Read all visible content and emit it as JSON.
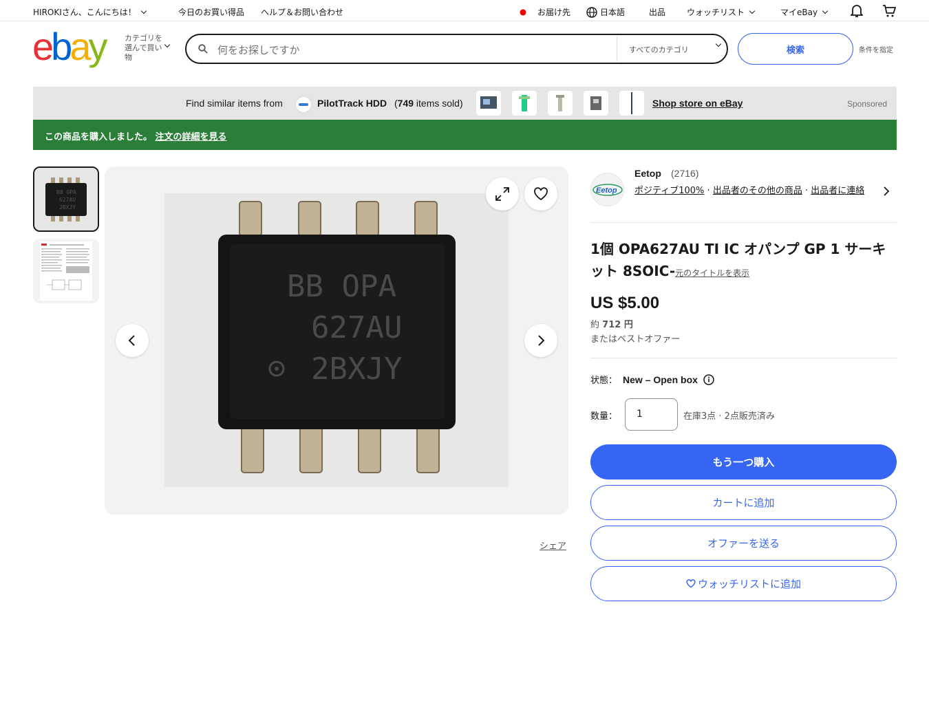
{
  "topbar": {
    "greeting": "HIROKIさん、こんにちは！",
    "deals": "今日のお買い得品",
    "help": "ヘルプ＆お問い合わせ",
    "ship_to": "お届け先",
    "language": "日本語",
    "sell": "出品",
    "watchlist": "ウォッチリスト",
    "my_ebay": "マイeBay"
  },
  "header": {
    "category_selector": "カテゴリを選んで買い物",
    "search_placeholder": "何をお探しですか",
    "search_category": "すべてのカテゴリ",
    "search_button": "検索",
    "advanced": "条件を指定"
  },
  "sponsored": {
    "find_text": "Find similar items from",
    "store_name": "PilotTrack HDD",
    "sold_prefix": "(",
    "sold_count": "749",
    "sold_suffix": "items sold)",
    "shop_link": "Shop store on eBay",
    "label": "Sponsored"
  },
  "banner": {
    "message": "この商品を購入しました。",
    "link": "注文の詳細を見る"
  },
  "gallery": {
    "chip_line1": "BB OPA",
    "chip_line2": "627AU",
    "chip_line3": "2BXJY",
    "share": "シェア"
  },
  "seller": {
    "logo_text": "Eetop",
    "name": "Eetop",
    "feedback_count": "(2716)",
    "positive": "ポジティブ100%",
    "other_items": "出品者のその他の商品",
    "contact": "出品者に連絡",
    "sep": "·"
  },
  "item": {
    "title": "1個 OPA627AU TI IC オパンプ GP 1 サーキット 8SOIC-",
    "show_original": "元のタイトルを表示",
    "price": "US $5.00",
    "approx_prefix": "約",
    "approx_value": "712 円",
    "best_offer": "またはベストオファー",
    "condition_label": "状態：",
    "condition_value": "New – Open box",
    "quantity_label": "数量：",
    "quantity_value": "1",
    "availability": "在庫3点 · 2点販売済み"
  },
  "actions": {
    "buy_again": "もう一つ購入",
    "add_to_cart": "カートに追加",
    "make_offer": "オファーを送る",
    "add_watchlist": "ウォッチリストに追加"
  },
  "colors": {
    "accent": "#3665f3",
    "banner": "#2a7e38"
  }
}
